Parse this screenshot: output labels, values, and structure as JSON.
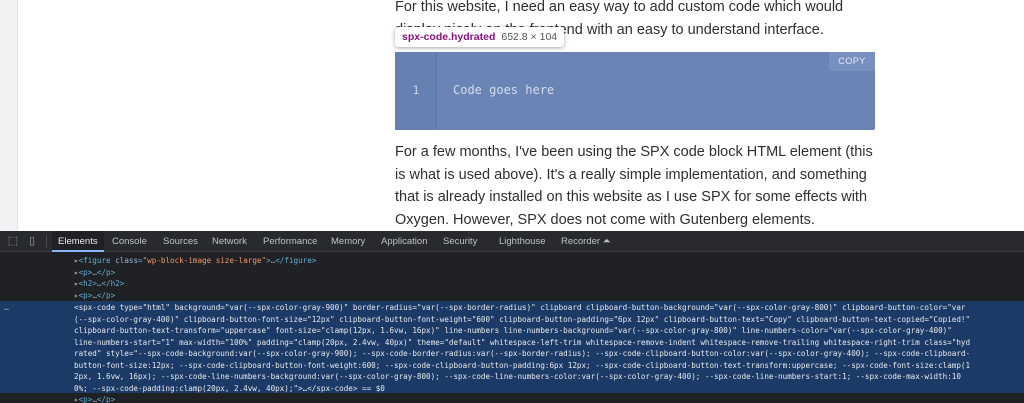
{
  "page": {
    "para1": "For this website, I need an easy way to add custom code which would display nicely on the frontend with an easy to understand interface.",
    "para2": "For a few months, I've been using the SPX code block HTML element (this is what is used above). It's a really simple implementation, and something that is already installed on this website as I use SPX for some effects with Oxygen. However, SPX does not come with Gutenberg elements. Because it is an HTML element, I would insert an HTML box into Gutenberg, and then implement the",
    "tooltip": {
      "tag": "spx-code.hydrated",
      "size": "652.8 × 104"
    },
    "code_block": {
      "line_number": "1",
      "placeholder": "Code goes here",
      "copy_label": "COPY"
    }
  },
  "devtools": {
    "tabs": [
      "Elements",
      "Console",
      "Sources",
      "Network",
      "Performance",
      "Memory",
      "Application",
      "Security",
      "Lighthouse",
      "Recorder ⏶"
    ],
    "active_tab": "Elements",
    "dom_rows": {
      "figure_tag": "figure",
      "figure_attr": "class",
      "figure_val": "\"wp-block-image size-large\"",
      "p1": "p",
      "h2": "h2",
      "p2": "p",
      "spx_lines": [
        "<spx-code type=\"html\" background=\"var(--spx-color-gray-900)\" border-radius=\"var(--spx-border-radius)\" clipboard clipboard-button-background=\"var(--spx-color-gray-800)\" clipboard-button-color=\"var",
        "(--spx-color-gray-400)\" clipboard-button-font-size=\"12px\" clipboard-button-font-weight=\"600\" clipboard-button-padding=\"6px 12px\" clipboard-button-text=\"Copy\" clipboard-button-text-copied=\"Copied!\"",
        "clipboard-button-text-transform=\"uppercase\" font-size=\"clamp(12px, 1.6vw, 16px)\" line-numbers line-numbers-background=\"var(--spx-color-gray-800)\" line-numbers-color=\"var(--spx-color-gray-400)\"",
        "line-numbers-start=\"1\" max-width=\"100%\" padding=\"clamp(20px, 2.4vw, 40px)\" theme=\"default\" whitespace-left-trim whitespace-remove-indent whitespace-remove-trailing whitespace-right-trim class=\"hyd",
        "rated\" style=\"--spx-code-background:var(--spx-color-gray-900); --spx-code-border-radius:var(--spx-border-radius); --spx-code-clipboard-button-color:var(--spx-color-gray-400); --spx-code-clipboard-",
        "button-font-size:12px; --spx-code-clipboard-button-font-weight:600; --spx-code-clipboard-button-padding:6px 12px; --spx-code-clipboard-button-text-transform:uppercase; --spx-code-font-size:clamp(1",
        "2px, 1.6vw, 16px); --spx-code-line-numbers-background:var(--spx-color-gray-800); --spx-code-line-numbers-color:var(--spx-color-gray-400); --spx-code-line-numbers-start:1; --spx-code-max-width:10",
        "0%; --spx-code-padding:clamp(20px, 2.4vw, 40px);\">…</spx-code> == $0"
      ],
      "p3": "p"
    },
    "selection_marker": "…"
  },
  "colors": {
    "code_bg": "#6b84b6",
    "devtools_bg": "#202124",
    "selection_bg": "#1b3a66"
  }
}
